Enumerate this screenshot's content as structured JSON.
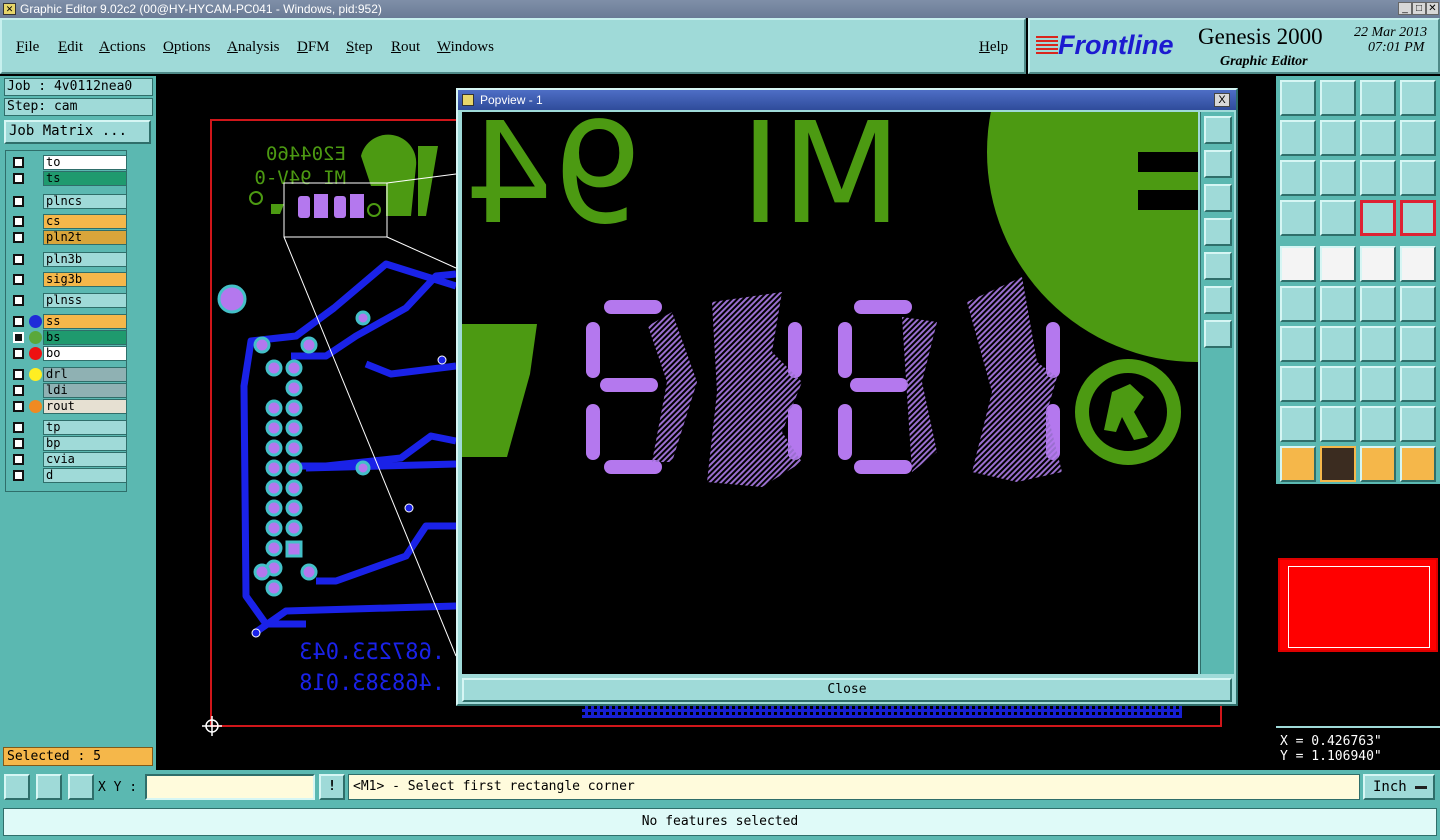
{
  "window": {
    "title": "Graphic Editor 9.02c2 (00@HY-HYCAM-PC041 - Windows, pid:952)"
  },
  "menu": [
    {
      "label": "File"
    },
    {
      "label": "Edit"
    },
    {
      "label": "Actions"
    },
    {
      "label": "Options"
    },
    {
      "label": "Analysis"
    },
    {
      "label": "DFM"
    },
    {
      "label": "Step"
    },
    {
      "label": "Rout"
    },
    {
      "label": "Windows"
    }
  ],
  "help_label": "Help",
  "brand": {
    "logo": "Frontline",
    "product": "Genesis 2000",
    "mode": "Graphic Editor",
    "date": "22 Mar 2013",
    "time": "07:01 PM"
  },
  "job": {
    "job": "Job : 4v0112nea0",
    "step": "Step: cam",
    "matrix_button": "Job Matrix ..."
  },
  "layers": [
    {
      "name": "to",
      "color": "#ffffff",
      "dot": ""
    },
    {
      "name": "ts",
      "color": "#1f9a6e",
      "dot": ""
    },
    {
      "name": "plncs",
      "color": "#9fdad8",
      "dot": ""
    },
    {
      "name": "cs",
      "color": "#f5b74a",
      "dot": ""
    },
    {
      "name": "pln2t",
      "color": "#d9a53a",
      "dot": ""
    },
    {
      "name": "pln3b",
      "color": "#9fdad8",
      "dot": ""
    },
    {
      "name": "sig3b",
      "color": "#f5b74a",
      "dot": ""
    },
    {
      "name": "plnss",
      "color": "#9fdad8",
      "dot": ""
    },
    {
      "name": "ss",
      "color": "#f5b74a",
      "dot": "#1f2bd8"
    },
    {
      "name": "bs",
      "color": "#1f9a6e",
      "dot": "#5aa83a"
    },
    {
      "name": "bo",
      "color": "#ffffff",
      "dot": "#ee1111"
    },
    {
      "name": "drl",
      "color": "#8fb1b3",
      "dot": "#ffee22"
    },
    {
      "name": "ldi",
      "color": "#8fb1b3",
      "dot": ""
    },
    {
      "name": "rout",
      "color": "#e6e0d2",
      "dot": "#f08a22"
    },
    {
      "name": "tp",
      "color": "#9fdad8",
      "dot": ""
    },
    {
      "name": "bp",
      "color": "#9fdad8",
      "dot": ""
    },
    {
      "name": "cvia",
      "color": "#9fdad8",
      "dot": ""
    },
    {
      "name": "d",
      "color": "#9fdad8",
      "dot": ""
    }
  ],
  "selected": "Selected : 5",
  "board": {
    "silk_line1": "E204460",
    "silk_line2": "MI 94V-0",
    "num_line1": ".687253.043",
    "num_line2": ".468383.018"
  },
  "popview": {
    "title": "Popview - 1",
    "close_x": "X",
    "zoom_text1": "MI",
    "zoom_text2": "94",
    "close_label": "Close"
  },
  "coords": {
    "x": "X = 0.426763\"",
    "y": "Y = 1.106940\""
  },
  "cmd": {
    "xy_label": "X Y :",
    "xy_value": "",
    "warn": "!",
    "prompt": "<M1> - Select first rectangle corner",
    "units": "Inch"
  },
  "status": "No features selected",
  "colors": {
    "panel": "#9fdad8",
    "panel_dark": "#5bb8b1",
    "accent": "#f5b74a",
    "trace": "#1a22e8",
    "silk_green": "#4c9a12",
    "purple": "#b478ee"
  }
}
